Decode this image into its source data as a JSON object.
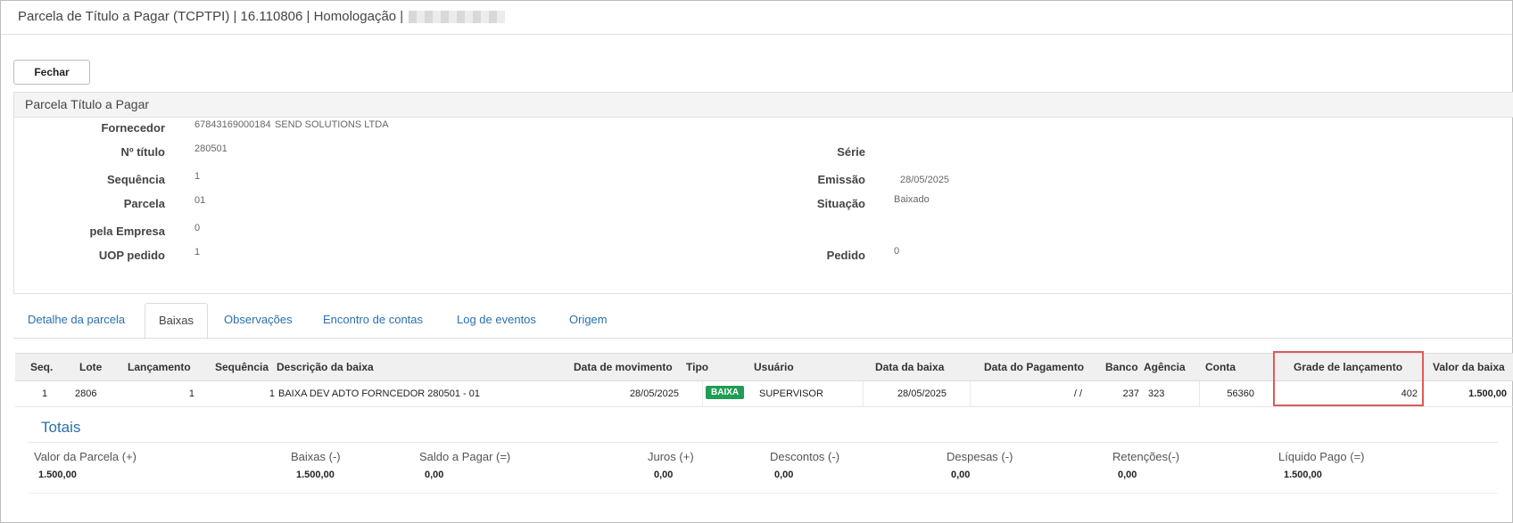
{
  "window": {
    "title": "Parcela de Título a Pagar (TCPTPI) | 16.110806 | Homologação | "
  },
  "toolbar": {
    "close_label": "Fechar"
  },
  "panel": {
    "title": "Parcela Título a Pagar",
    "fields": {
      "fornecedor_label": "Fornecedor",
      "fornecedor_code": "67843169000184",
      "fornecedor_name": "SEND SOLUTIONS LTDA",
      "titulo_label": "Nº título",
      "titulo_value": "280501",
      "serie_label": "Série",
      "serie_value": "",
      "sequencia_label": "Sequência",
      "sequencia_value": "1",
      "emissao_label": "Emissão",
      "emissao_value": "28/05/2025",
      "parcela_label": "Parcela",
      "parcela_value": "01",
      "situacao_label": "Situação",
      "situacao_value": "Baixado",
      "empresa_label": "pela Empresa",
      "empresa_value": "0",
      "uop_label": "UOP pedido",
      "uop_value": "1",
      "pedido_label": "Pedido",
      "pedido_value": "0"
    }
  },
  "tabs": [
    {
      "label": "Detalhe da parcela",
      "active": false
    },
    {
      "label": "Baixas",
      "active": true
    },
    {
      "label": "Observações",
      "active": false
    },
    {
      "label": "Encontro de contas",
      "active": false
    },
    {
      "label": "Log de eventos",
      "active": false
    },
    {
      "label": "Origem",
      "active": false
    }
  ],
  "grid": {
    "columns": [
      "Seq.",
      "Lote",
      "Lançamento",
      "Sequência",
      "Descrição da baixa",
      "Data de movimento",
      "Tipo",
      "Usuário",
      "Data da baixa",
      "Data do Pagamento",
      "Banco",
      "Agência",
      "Conta",
      "Grade de lançamento",
      "Valor da baixa"
    ],
    "rows": [
      {
        "seq": "1",
        "lote": "2806",
        "lancamento": "1",
        "sequencia": "1",
        "descricao": "BAIXA DEV ADTO FORNCEDOR 280501 - 01",
        "data_movimento": "28/05/2025",
        "tipo": "BAIXA",
        "usuario": "SUPERVISOR",
        "data_baixa": "28/05/2025",
        "data_pagamento": "/ /",
        "banco": "237",
        "agencia": "323",
        "conta": "56360",
        "grade": "402",
        "valor": "1.500,00"
      }
    ]
  },
  "totais": {
    "title": "Totais",
    "items": [
      {
        "label": "Valor da Parcela (+)",
        "value": "1.500,00"
      },
      {
        "label": "Baixas (-)",
        "value": "1.500,00"
      },
      {
        "label": "Saldo a Pagar (=)",
        "value": "0,00"
      },
      {
        "label": "Juros (+)",
        "value": "0,00"
      },
      {
        "label": "Descontos (-)",
        "value": "0,00"
      },
      {
        "label": "Despesas (-)",
        "value": "0,00"
      },
      {
        "label": "Retenções(-)",
        "value": "0,00"
      },
      {
        "label": "Líquido Pago (=)",
        "value": "1.500,00"
      }
    ]
  },
  "colors": {
    "accent": "#2a6fb0",
    "badge": "#1f9d55",
    "highlight": "#e05a5a"
  }
}
